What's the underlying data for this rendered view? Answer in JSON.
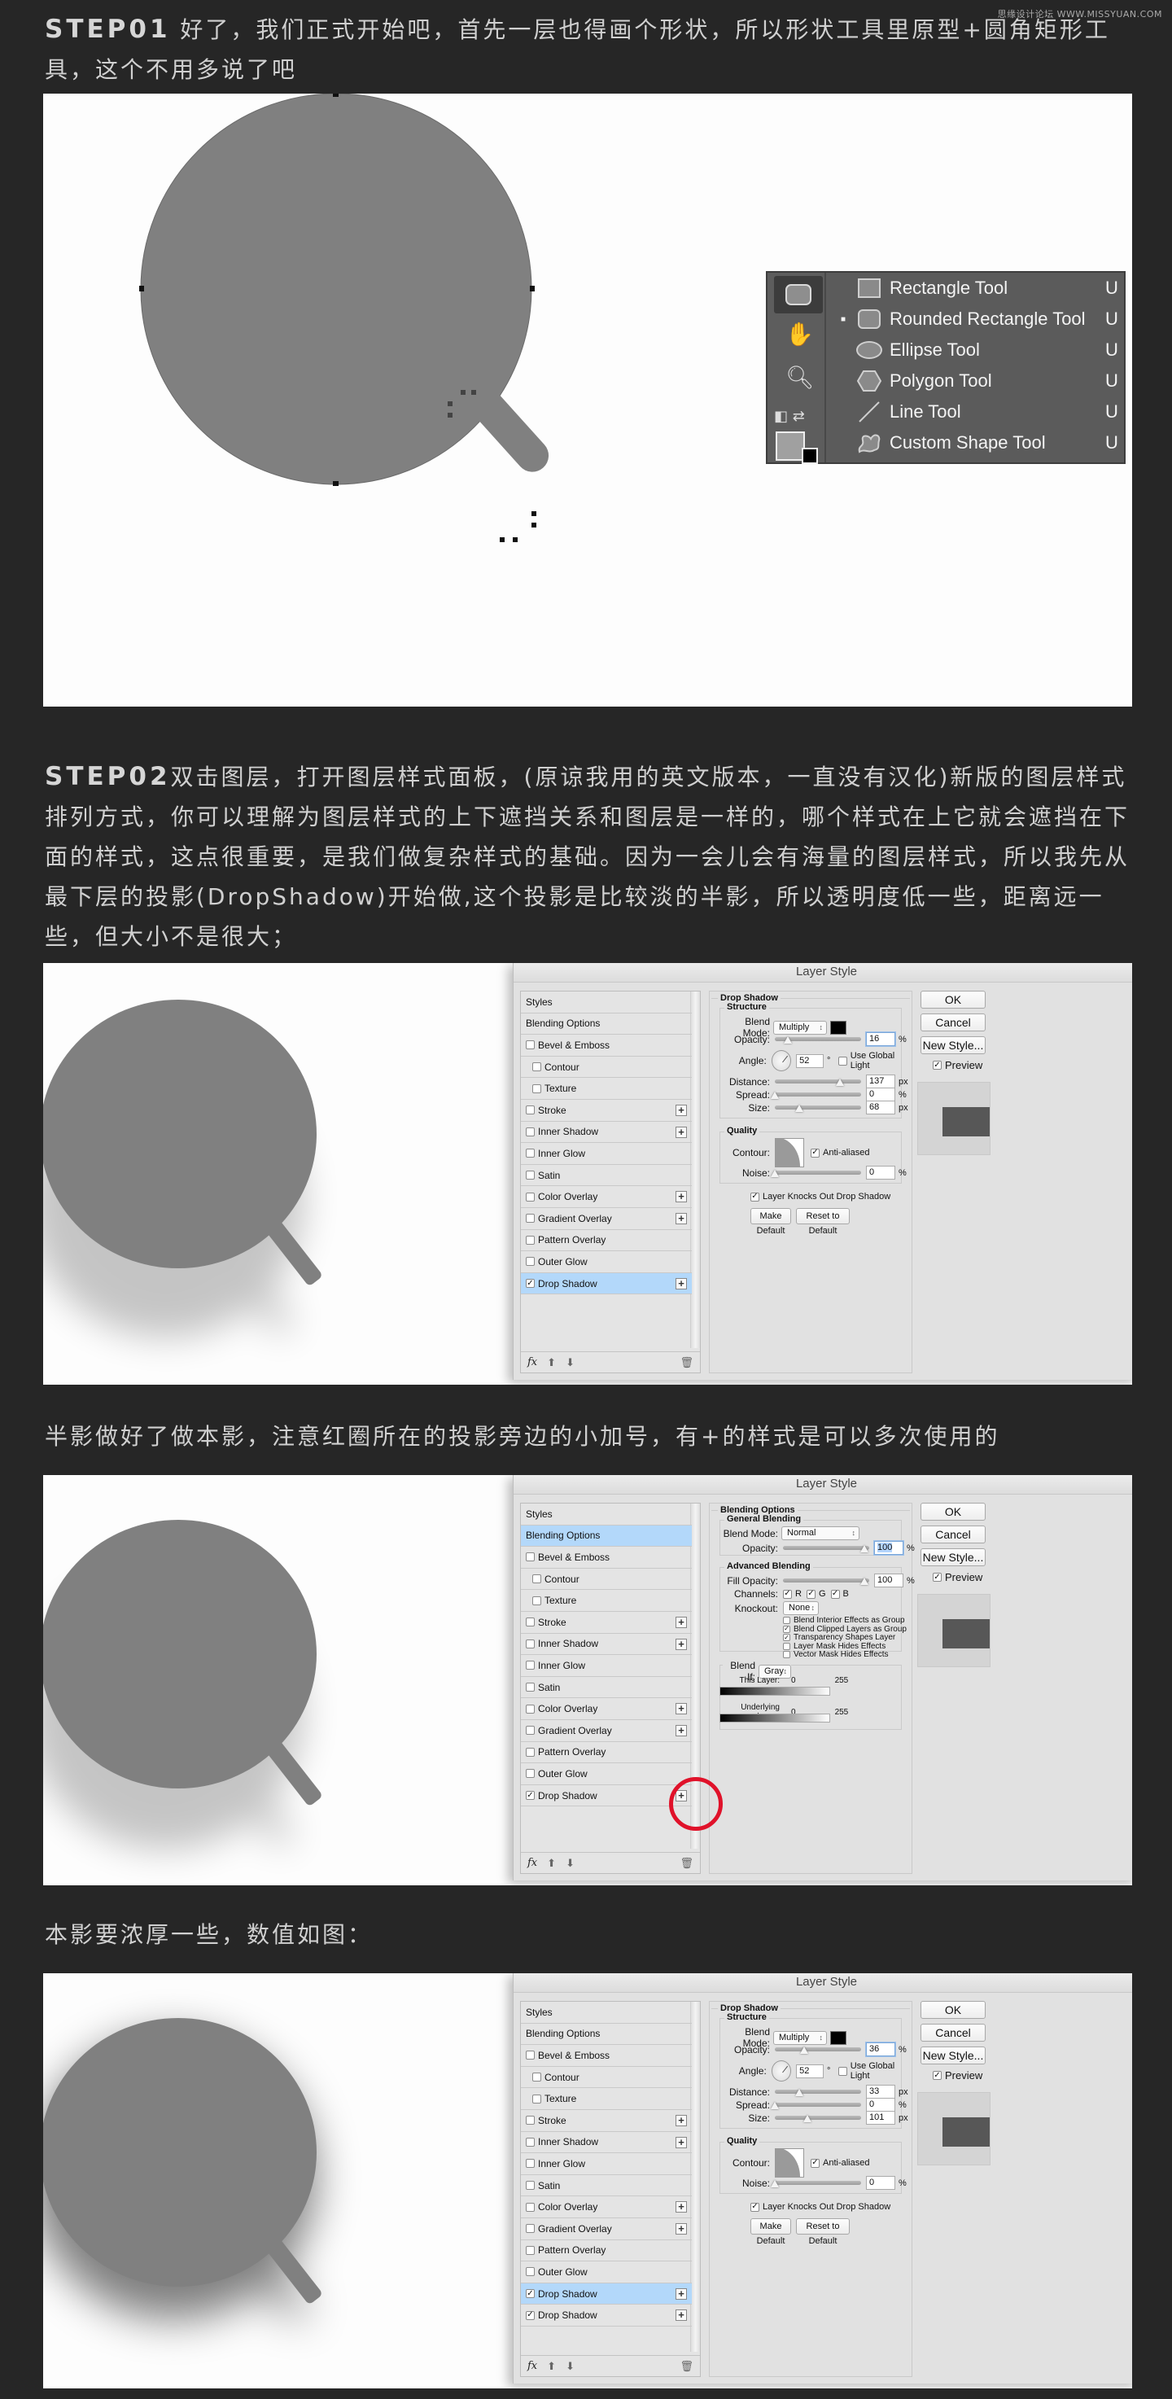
{
  "watermark": "思缘设计论坛 WWW.MISSYUAN.COM",
  "step1": {
    "label": "STEP01",
    "text": " 好了，我们正式开始吧，首先一层也得画个形状，所以形状工具里原型+圆角矩形工具，这个不用多说了吧"
  },
  "shape_tools": {
    "items": [
      {
        "label": "Rectangle Tool",
        "key": "U",
        "icon": "rectangle-icon",
        "selected": false
      },
      {
        "label": "Rounded Rectangle Tool",
        "key": "U",
        "icon": "rounded-rectangle-icon",
        "selected": true
      },
      {
        "label": "Ellipse Tool",
        "key": "U",
        "icon": "ellipse-icon",
        "selected": false
      },
      {
        "label": "Polygon Tool",
        "key": "U",
        "icon": "polygon-icon",
        "selected": false
      },
      {
        "label": "Line Tool",
        "key": "U",
        "icon": "line-icon",
        "selected": false
      },
      {
        "label": "Custom Shape Tool",
        "key": "U",
        "icon": "custom-shape-icon",
        "selected": false
      }
    ],
    "strip_icons": [
      "rounded-rectangle-icon",
      "hand-icon",
      "zoom-icon",
      "swap-colors-icon"
    ],
    "foreground_color": "#a0a0a0",
    "background_color": "#000000"
  },
  "step2": {
    "label": "STEP02",
    "text": "双击图层，打开图层样式面板，(原谅我用的英文版本，一直没有汉化)新版的图层样式排列方式，你可以理解为图层样式的上下遮挡关系和图层是一样的，哪个样式在上它就会遮挡在下面的样式，这点很重要，是我们做复杂样式的基础。因为一会儿会有海量的图层样式，所以我先从最下层的投影(DropShadow)开始做,这个投影是比较淡的半影，所以透明度低一些，距离远一些，但大小不是很大；"
  },
  "text3": "半影做好了做本影，注意红圈所在的投影旁边的小加号，有+的样式是可以多次使用的",
  "text4": "本影要浓厚一些，数值如图：",
  "dialog": {
    "title": "Layer Style",
    "ok": "OK",
    "cancel": "Cancel",
    "new_style": "New Style...",
    "preview": "Preview",
    "styles_header": "Styles",
    "blending_options": "Blending Options",
    "fx": "fx",
    "ds_title": "Drop Shadow",
    "structure": "Structure",
    "quality": "Quality",
    "blend_mode_label": "Blend Mode:",
    "opacity_label": "Opacity:",
    "angle_label": "Angle:",
    "distance_label": "Distance:",
    "spread_label": "Spread:",
    "size_label": "Size:",
    "contour_label": "Contour:",
    "anti_aliased": "Anti-aliased",
    "noise_label": "Noise:",
    "use_global_light": "Use Global Light",
    "knocks_out": "Layer Knocks Out Drop Shadow",
    "make_default": "Make Default",
    "reset_default": "Reset to Default",
    "px": "px",
    "pct": "%",
    "deg": "°"
  },
  "dialog1": {
    "list": [
      {
        "label": "Bevel & Emboss",
        "checked": false,
        "indent": false,
        "plus": false
      },
      {
        "label": "Contour",
        "checked": false,
        "indent": true,
        "plus": false
      },
      {
        "label": "Texture",
        "checked": false,
        "indent": true,
        "plus": false
      },
      {
        "label": "Stroke",
        "checked": false,
        "indent": false,
        "plus": true
      },
      {
        "label": "Inner Shadow",
        "checked": false,
        "indent": false,
        "plus": true
      },
      {
        "label": "Inner Glow",
        "checked": false,
        "indent": false,
        "plus": false
      },
      {
        "label": "Satin",
        "checked": false,
        "indent": false,
        "plus": false
      },
      {
        "label": "Color Overlay",
        "checked": false,
        "indent": false,
        "plus": true
      },
      {
        "label": "Gradient Overlay",
        "checked": false,
        "indent": false,
        "plus": true
      },
      {
        "label": "Pattern Overlay",
        "checked": false,
        "indent": false,
        "plus": false
      },
      {
        "label": "Outer Glow",
        "checked": false,
        "indent": false,
        "plus": false
      },
      {
        "label": "Drop Shadow",
        "checked": true,
        "indent": false,
        "plus": true,
        "selected": true
      }
    ],
    "blend_mode": "Multiply",
    "opacity": "16",
    "angle": "52",
    "distance": "137",
    "spread": "0",
    "size": "68",
    "noise": "0",
    "opacity_pct": 16,
    "distance_frac": 0.8,
    "spread_pct": 0,
    "size_frac": 0.3,
    "noise_pct": 0
  },
  "dialog2": {
    "list": [
      {
        "label": "Bevel & Emboss",
        "checked": false,
        "indent": false,
        "plus": false
      },
      {
        "label": "Contour",
        "checked": false,
        "indent": true,
        "plus": false
      },
      {
        "label": "Texture",
        "checked": false,
        "indent": true,
        "plus": false
      },
      {
        "label": "Stroke",
        "checked": false,
        "indent": false,
        "plus": true
      },
      {
        "label": "Inner Shadow",
        "checked": false,
        "indent": false,
        "plus": true
      },
      {
        "label": "Inner Glow",
        "checked": false,
        "indent": false,
        "plus": false
      },
      {
        "label": "Satin",
        "checked": false,
        "indent": false,
        "plus": false
      },
      {
        "label": "Color Overlay",
        "checked": false,
        "indent": false,
        "plus": true
      },
      {
        "label": "Gradient Overlay",
        "checked": false,
        "indent": false,
        "plus": true
      },
      {
        "label": "Pattern Overlay",
        "checked": false,
        "indent": false,
        "plus": false
      },
      {
        "label": "Outer Glow",
        "checked": false,
        "indent": false,
        "plus": false
      },
      {
        "label": "Drop Shadow",
        "checked": true,
        "indent": false,
        "plus": true
      }
    ],
    "blending_title": "Blending Options",
    "general_blending": "General Blending",
    "advanced_blending": "Advanced Blending",
    "blend_mode": "Normal",
    "opacity": "100",
    "fill_opacity_label": "Fill Opacity:",
    "fill_opacity": "100",
    "channels_label": "Channels:",
    "channels": [
      "R",
      "G",
      "B"
    ],
    "knockout_label": "Knockout:",
    "knockout": "None",
    "options": [
      {
        "label": "Blend Interior Effects as Group",
        "checked": false
      },
      {
        "label": "Blend Clipped Layers as Group",
        "checked": true
      },
      {
        "label": "Transparency Shapes Layer",
        "checked": true
      },
      {
        "label": "Layer Mask Hides Effects",
        "checked": false
      },
      {
        "label": "Vector Mask Hides Effects",
        "checked": false
      }
    ],
    "blend_if_label": "Blend If:",
    "blend_if": "Gray",
    "this_layer": "This Layer:",
    "underlying_layer": "Underlying Layer:",
    "range_low": "0",
    "range_high": "255",
    "highlight_color": "#e0122a"
  },
  "dialog3": {
    "list": [
      {
        "label": "Bevel & Emboss",
        "checked": false,
        "indent": false,
        "plus": false
      },
      {
        "label": "Contour",
        "checked": false,
        "indent": true,
        "plus": false
      },
      {
        "label": "Texture",
        "checked": false,
        "indent": true,
        "plus": false
      },
      {
        "label": "Stroke",
        "checked": false,
        "indent": false,
        "plus": true
      },
      {
        "label": "Inner Shadow",
        "checked": false,
        "indent": false,
        "plus": true
      },
      {
        "label": "Inner Glow",
        "checked": false,
        "indent": false,
        "plus": false
      },
      {
        "label": "Satin",
        "checked": false,
        "indent": false,
        "plus": false
      },
      {
        "label": "Color Overlay",
        "checked": false,
        "indent": false,
        "plus": true
      },
      {
        "label": "Gradient Overlay",
        "checked": false,
        "indent": false,
        "plus": true
      },
      {
        "label": "Pattern Overlay",
        "checked": false,
        "indent": false,
        "plus": false
      },
      {
        "label": "Outer Glow",
        "checked": false,
        "indent": false,
        "plus": false
      },
      {
        "label": "Drop Shadow",
        "checked": true,
        "indent": false,
        "plus": true,
        "selected": true
      },
      {
        "label": "Drop Shadow",
        "checked": true,
        "indent": false,
        "plus": true
      }
    ],
    "blend_mode": "Multiply",
    "opacity": "36",
    "angle": "52",
    "distance": "33",
    "spread": "0",
    "size": "101",
    "noise": "0",
    "opacity_pct": 36,
    "distance_frac": 0.3,
    "spread_pct": 0,
    "size_frac": 0.4,
    "noise_pct": 0
  },
  "colors": {
    "page_bg": "#262626",
    "shape_fill": "#808080",
    "selected_row": "#b3d8fa"
  }
}
